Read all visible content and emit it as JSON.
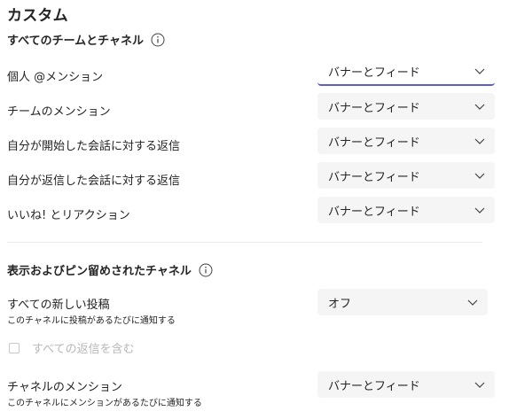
{
  "page": {
    "title": "カスタム"
  },
  "all_teams": {
    "heading": "すべてのチームとチャネル",
    "rows": [
      {
        "label": "個人 @メンション",
        "value": "バナーとフィード"
      },
      {
        "label": "チームのメンション",
        "value": "バナーとフィード"
      },
      {
        "label": "自分が開始した会話に対する返信",
        "value": "バナーとフィード"
      },
      {
        "label": "自分が返信した会話に対する返信",
        "value": "バナーとフィード"
      },
      {
        "label": "いいね! とリアクション",
        "value": "バナーとフィード"
      }
    ]
  },
  "pinned": {
    "heading": "表示およびピン留めされたチャネル",
    "all_posts": {
      "label": "すべての新しい投稿",
      "sublabel": "このチャネルに投稿があるたびに通知する",
      "value": "オフ"
    },
    "include_replies": {
      "label": "すべての返信を含む",
      "checked": false
    },
    "channel_mentions": {
      "label": "チャネルのメンション",
      "sublabel": "このチャネルにメンションがあるたびに通知する",
      "value": "バナーとフィード"
    }
  },
  "colors": {
    "focus_underline": "#5b5fc7",
    "dropdown_bg": "#f5f5f5"
  }
}
